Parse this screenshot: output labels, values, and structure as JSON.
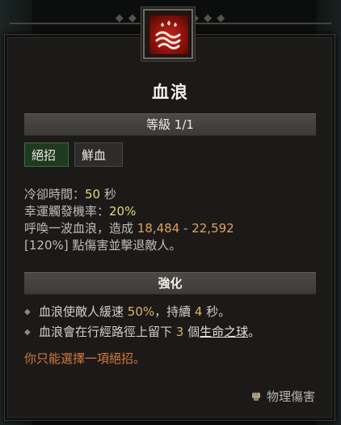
{
  "skill": {
    "name": "血浪",
    "level": "等級 1/1",
    "icon": "blood-wave-icon",
    "tags": [
      "絕招",
      "鮮血"
    ]
  },
  "stats": {
    "cooldown_label": "冷卻時間：",
    "cooldown_value": "50",
    "cooldown_unit": " 秒",
    "lucky_label": "幸運觸發機率：",
    "lucky_value": "20%",
    "desc_prefix": "呼喚一波血浪，造成 ",
    "damage_range": "18,484 - 22,592",
    "desc_line2": "[120%] 點傷害並擊退敵人。"
  },
  "enhancement": {
    "header": "強化",
    "bullet1_prefix": "血浪使敵人緩速 ",
    "bullet1_value": "50%",
    "bullet1_mid": "，持續 ",
    "bullet1_value2": "4",
    "bullet1_suffix": " 秒。",
    "bullet2_prefix": "血浪會在行經路徑上留下 ",
    "bullet2_value": "3",
    "bullet2_mid": " 個",
    "bullet2_link": "生命之球",
    "bullet2_suffix": "。"
  },
  "note": "你只能選擇一項絕招。",
  "footer": {
    "damage_type": "物理傷害",
    "icon": "fist-icon"
  },
  "colors": {
    "accent_yellow": "#e7d77a",
    "accent_orange": "#e0a35a",
    "warning": "#d47a3c",
    "ultimate_tag_bg": "#1e3a20",
    "icon_red": "#c2281c"
  }
}
